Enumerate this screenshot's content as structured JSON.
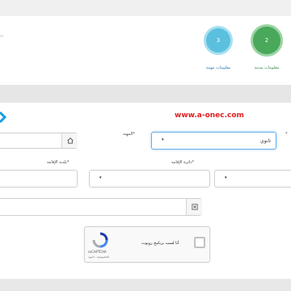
{
  "steps": [
    {
      "number": "3",
      "label": "معلومات مهنية",
      "color": "#5bc0de",
      "ring": "#a8dff0"
    },
    {
      "number": "2",
      "label": "معلومات مدنية",
      "color": "#49a85a",
      "ring": "#9ad3a3"
    }
  ],
  "site_url": "www.a-onec.com",
  "form": {
    "profession_label": "المهنة*",
    "profession_value": "ثانوي",
    "residence_state_label": "دائرة الإقامة*",
    "residence_municipality_label": "بلدية الإقامة*",
    "left_mark": "*"
  },
  "captcha": {
    "checkbox_text": "أنا لست برنامج روبوت",
    "brand": "reCAPTCHA",
    "footer": "الخصوصية - البنود"
  },
  "colors": {
    "accent_blue": "#1a9fe0",
    "url_red": "#e02020",
    "band_gray": "#e4e4e4"
  }
}
